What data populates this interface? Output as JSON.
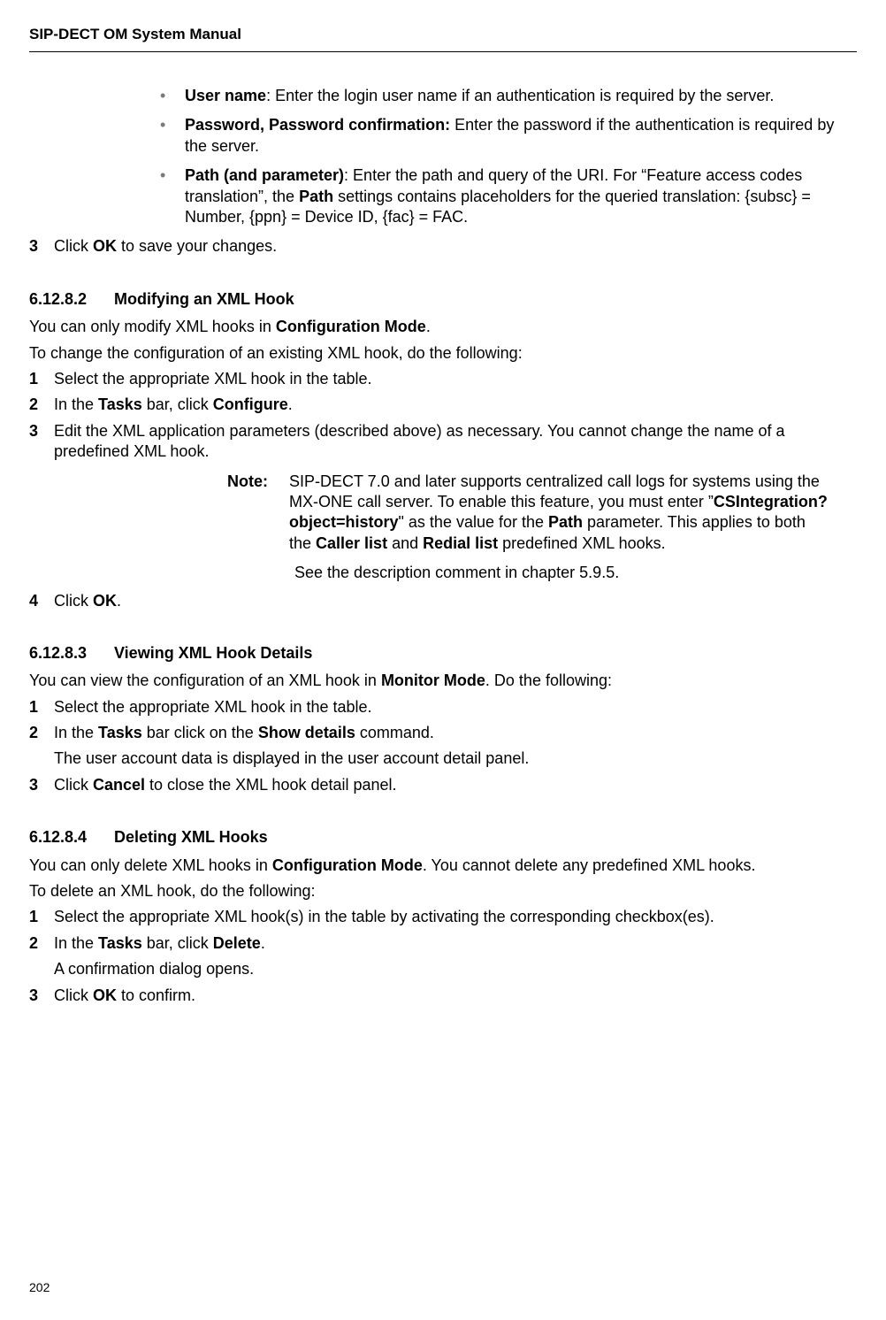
{
  "header": {
    "title": "SIP-DECT OM System Manual"
  },
  "page_number": "202",
  "bullets": {
    "b1_label": "User name",
    "b1_text": ": Enter the login user name if an authentication is required by the server.",
    "b2_label": "Password, Password confirmation:",
    "b2_text": " Enter the password if the authentication is required by the server.",
    "b3_label": "Path (and parameter)",
    "b3_text_a": ": Enter the path and query of the URI. For “Feature access codes translation”, the ",
    "b3_bold_path": "Path",
    "b3_text_b": " settings contains placeholders for the queried translation: {subsc} = Number, {ppn} = Device ID, {fac} = FAC."
  },
  "step_top": {
    "num": "3",
    "a": "Click ",
    "ok": "OK",
    "b": " to save your changes."
  },
  "s1": {
    "num": "6.12.8.2",
    "title": "Modifying an XML Hook",
    "p1_a": "You can only modify XML hooks in ",
    "p1_b": "Configuration Mode",
    "p1_c": ".",
    "p2": "To change the configuration of an existing XML hook, do the following:",
    "i1_num": "1",
    "i1": "Select the appropriate XML hook in the table.",
    "i2_num": "2",
    "i2_a": "In the ",
    "i2_b": "Tasks",
    "i2_c": " bar, click ",
    "i2_d": "Configure",
    "i2_e": ".",
    "i3_num": "3",
    "i3": "Edit the XML application parameters (described above) as necessary.  You cannot change the name of a predefined XML hook.",
    "note_label": "Note:",
    "note_a": "SIP-DECT 7.0 and later supports centralized call logs for systems using the MX-ONE call server. To enable this feature, you must enter ”",
    "note_csi": "CSIntegration?object=history",
    "note_b": "\" as the value for the ",
    "note_path": "Path",
    "note_c": " parameter. This applies to both the ",
    "note_caller": "Caller list",
    "note_d": " and ",
    "note_redial": "Redial list",
    "note_e": " predefined XML hooks.",
    "note_p2": "See the description comment in chapter 5.9.5.",
    "i4_num": "4",
    "i4_a": "Click ",
    "i4_b": "OK",
    "i4_c": "."
  },
  "s2": {
    "num": "6.12.8.3",
    "title": "Viewing XML Hook Details",
    "p1_a": "You can view the configuration of an XML hook in ",
    "p1_b": "Monitor Mode",
    "p1_c": ". Do the following:",
    "i1_num": "1",
    "i1": "Select the appropriate XML hook in the table.",
    "i2_num": "2",
    "i2_a": "In the ",
    "i2_b": "Tasks",
    "i2_c": " bar click on the ",
    "i2_d": "Show details",
    "i2_e": " command.",
    "sub": "The user account data is displayed in the user account detail panel.",
    "i3_num": "3",
    "i3_a": "Click ",
    "i3_b": "Cancel",
    "i3_c": " to close the XML hook detail panel."
  },
  "s3": {
    "num": "6.12.8.4",
    "title": "Deleting XML Hooks",
    "p1_a": "You can only delete XML hooks in ",
    "p1_b": "Configuration Mode",
    "p1_c": ". You cannot delete any predefined XML hooks.",
    "p2": "To delete an XML hook, do the following:",
    "i1_num": "1",
    "i1": "Select the appropriate XML hook(s) in the table by activating the corresponding checkbox(es).",
    "i2_num": "2",
    "i2_a": "In the ",
    "i2_b": "Tasks",
    "i2_c": " bar, click ",
    "i2_d": "Delete",
    "i2_e": ".",
    "sub": "A confirmation dialog opens.",
    "i3_num": "3",
    "i3_a": "Click ",
    "i3_b": "OK",
    "i3_c": " to confirm."
  }
}
